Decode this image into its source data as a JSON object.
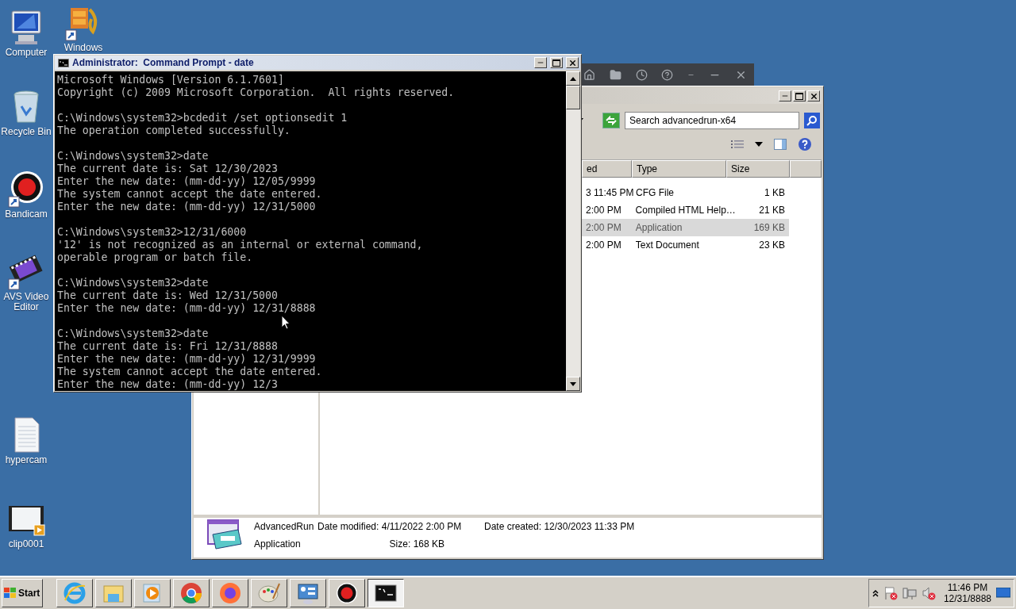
{
  "desktop_icons": [
    {
      "label": "Computer",
      "kind": "computer"
    },
    {
      "label": "Windows",
      "kind": "movie"
    },
    {
      "label": "Recycle Bin",
      "kind": "bin"
    },
    {
      "label": "Bandicam",
      "kind": "record"
    },
    {
      "label": "AVS Video Editor",
      "kind": "film"
    },
    {
      "label": "hypercam",
      "kind": "document"
    },
    {
      "label": "clip0001",
      "kind": "video"
    }
  ],
  "explorer_window": {
    "search": {
      "placeholder": "Search advancedrun-x64"
    },
    "columns": [
      "ed",
      "Type",
      "Size"
    ],
    "rows": [
      {
        "date": "3 11:45 PM",
        "type": "CFG File",
        "size": "1 KB",
        "selected": false
      },
      {
        "date": "2:00 PM",
        "type": "Compiled HTML Help…",
        "size": "21 KB",
        "selected": false
      },
      {
        "date": "2:00 PM",
        "type": "Application",
        "size": "169 KB",
        "selected": true
      },
      {
        "date": "2:00 PM",
        "type": "Text Document",
        "size": "23 KB",
        "selected": false
      }
    ],
    "details": {
      "name": "AdvancedRun",
      "type": "Application",
      "modified_label": "Date modified:",
      "modified": "4/11/2022 2:00 PM",
      "size_label": "Size:",
      "size": "168 KB",
      "created_label": "Date created:",
      "created": "12/30/2023 11:33 PM"
    }
  },
  "console_window": {
    "title": "Administrator:  Command Prompt - date",
    "blocks": [
      [
        "Microsoft Windows [Version 6.1.7601]",
        "Copyright (c) 2009 Microsoft Corporation.  All rights reserved."
      ],
      [
        "C:\\Windows\\system32>bcdedit /set optionsedit 1",
        "The operation completed successfully."
      ],
      [
        "C:\\Windows\\system32>date",
        "The current date is: Sat 12/30/2023",
        "Enter the new date: (mm-dd-yy) 12/05/9999",
        "The system cannot accept the date entered.",
        "Enter the new date: (mm-dd-yy) 12/31/5000"
      ],
      [
        "C:\\Windows\\system32>12/31/6000",
        "'12' is not recognized as an internal or external command,",
        "operable program or batch file."
      ],
      [
        "C:\\Windows\\system32>date",
        "The current date is: Wed 12/31/5000",
        "Enter the new date: (mm-dd-yy) 12/31/8888"
      ],
      [
        "C:\\Windows\\system32>date",
        "The current date is: Fri 12/31/8888",
        "Enter the new date: (mm-dd-yy) 12/31/9999",
        "The system cannot accept the date entered.",
        "Enter the new date: (mm-dd-yy) 12/3"
      ]
    ]
  },
  "taskbar": {
    "start": "Start",
    "buttons": [
      {
        "kind": "ie",
        "selected": false
      },
      {
        "kind": "explorer",
        "selected": false
      },
      {
        "kind": "media",
        "selected": false
      },
      {
        "kind": "chrome",
        "selected": false
      },
      {
        "kind": "firefox",
        "selected": false
      },
      {
        "kind": "paint",
        "selected": false
      },
      {
        "kind": "control",
        "selected": false
      },
      {
        "kind": "record",
        "selected": false
      },
      {
        "kind": "console",
        "selected": true
      }
    ],
    "clock": {
      "time": "11:46 PM",
      "date": "12/31/8888"
    }
  }
}
